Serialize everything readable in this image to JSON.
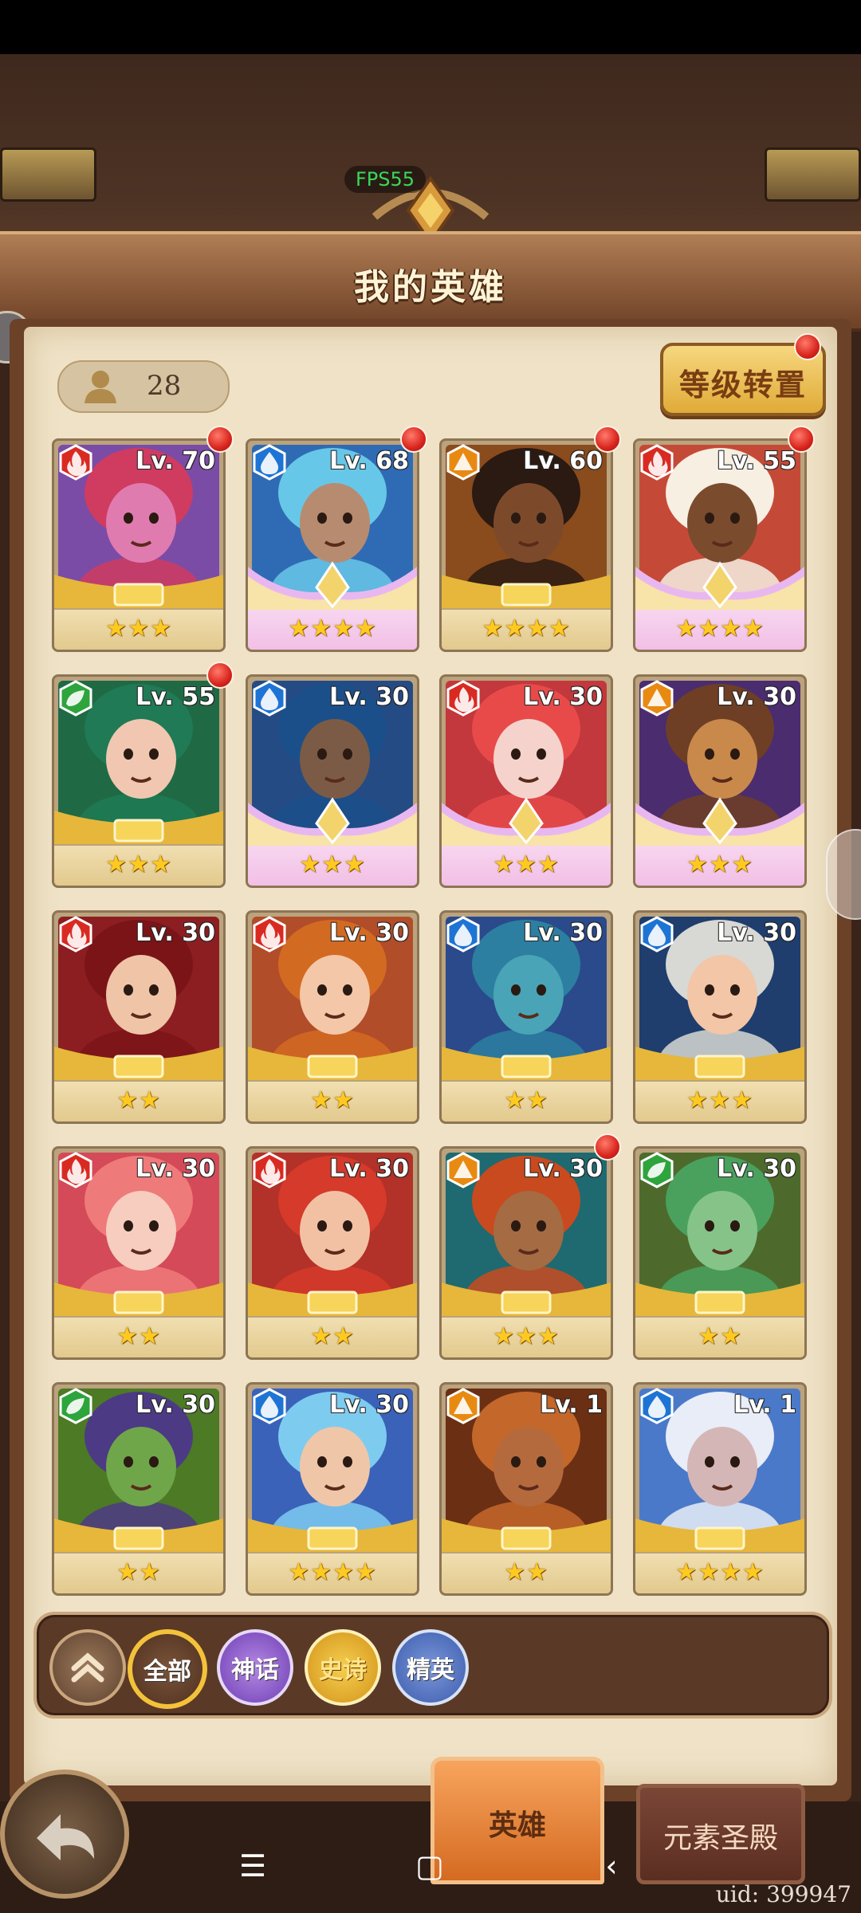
{
  "overlay": {
    "fps": "FPS55",
    "uid": "uid: 399947"
  },
  "header": {
    "title": "我的英雄"
  },
  "toolbar": {
    "hero_count": "28",
    "level_reset_label": "等级转置"
  },
  "filters": {
    "all": "全部",
    "mythic": "神话",
    "epic": "史诗",
    "elite": "精英"
  },
  "bottom_tabs": {
    "hero": "英雄",
    "element_temple": "元素圣殿"
  },
  "colors": {
    "fire": "#d92a22",
    "water": "#1e74d4",
    "earth": "#e88a12",
    "wood": "#2ea43c"
  },
  "heroes": [
    {
      "level": "Lv. 70",
      "stars": "★★★",
      "element": "fire",
      "rarity": "gold",
      "badge": true,
      "bg": "#7b4ca6",
      "skin": "#e07bb0",
      "hair": "#d03b60"
    },
    {
      "level": "Lv. 68",
      "stars": "★★★★",
      "element": "water",
      "rarity": "pink",
      "badge": true,
      "bg": "#2f6bb4",
      "skin": "#b78b70",
      "hair": "#67c7e8"
    },
    {
      "level": "Lv. 60",
      "stars": "★★★★",
      "element": "earth",
      "rarity": "gold",
      "badge": true,
      "bg": "#8a4b1d",
      "skin": "#7c4a2b",
      "hair": "#2a1a12"
    },
    {
      "level": "Lv. 55",
      "stars": "★★★★",
      "element": "fire",
      "rarity": "pink",
      "badge": true,
      "bg": "#c44a37",
      "skin": "#7b4b2e",
      "hair": "#f6efe2"
    },
    {
      "level": "Lv. 55",
      "stars": "★★★",
      "element": "wood",
      "rarity": "gold",
      "badge": true,
      "bg": "#1f6a45",
      "skin": "#f1c7b1",
      "hair": "#1f7a55"
    },
    {
      "level": "Lv. 30",
      "stars": "★★★",
      "element": "water",
      "rarity": "pink",
      "badge": false,
      "bg": "#254b85",
      "skin": "#7b5b45",
      "hair": "#1b4f8a"
    },
    {
      "level": "Lv. 30",
      "stars": "★★★",
      "element": "fire",
      "rarity": "pink",
      "badge": false,
      "bg": "#c3383c",
      "skin": "#f5d3cc",
      "hair": "#e84a4a"
    },
    {
      "level": "Lv. 30",
      "stars": "★★★",
      "element": "earth",
      "rarity": "pink",
      "badge": false,
      "bg": "#4a2c6f",
      "skin": "#c9894a",
      "hair": "#6e3f25"
    },
    {
      "level": "Lv. 30",
      "stars": "★★",
      "element": "fire",
      "rarity": "gold",
      "badge": false,
      "bg": "#8c1e21",
      "skin": "#f0c4a6",
      "hair": "#7a1417"
    },
    {
      "level": "Lv. 30",
      "stars": "★★",
      "element": "fire",
      "rarity": "gold",
      "badge": false,
      "bg": "#b14d29",
      "skin": "#f3c7a8",
      "hair": "#d36a22"
    },
    {
      "level": "Lv. 30",
      "stars": "★★",
      "element": "water",
      "rarity": "gold",
      "badge": false,
      "bg": "#2a4a8c",
      "skin": "#48a4b6",
      "hair": "#2c7fa0"
    },
    {
      "level": "Lv. 30",
      "stars": "★★★",
      "element": "water",
      "rarity": "gold",
      "badge": false,
      "bg": "#1f3d6d",
      "skin": "#f2c6a6",
      "hair": "#d8d8d4"
    },
    {
      "level": "Lv. 30",
      "stars": "★★",
      "element": "fire",
      "rarity": "gold",
      "badge": false,
      "bg": "#d44a58",
      "skin": "#f6cdbf",
      "hair": "#ef7a7a"
    },
    {
      "level": "Lv. 30",
      "stars": "★★",
      "element": "fire",
      "rarity": "gold",
      "badge": false,
      "bg": "#b23128",
      "skin": "#f2c1a4",
      "hair": "#d53a2a"
    },
    {
      "level": "Lv. 30",
      "stars": "★★★",
      "element": "earth",
      "rarity": "gold",
      "badge": true,
      "bg": "#1e6a70",
      "skin": "#a56b43",
      "hair": "#c94a1e"
    },
    {
      "level": "Lv. 30",
      "stars": "★★",
      "element": "wood",
      "rarity": "gold",
      "badge": false,
      "bg": "#4d6a2c",
      "skin": "#85c389",
      "hair": "#4aa15e"
    },
    {
      "level": "Lv. 30",
      "stars": "★★",
      "element": "wood",
      "rarity": "gold",
      "badge": false,
      "bg": "#4d7a25",
      "skin": "#6fa64a",
      "hair": "#4d3a85"
    },
    {
      "level": "Lv. 30",
      "stars": "★★★★",
      "element": "water",
      "rarity": "gold",
      "badge": false,
      "bg": "#3a62b9",
      "skin": "#f0c6a8",
      "hair": "#7ecbf0"
    },
    {
      "level": "Lv. 1",
      "stars": "★★",
      "element": "earth",
      "rarity": "gold",
      "badge": false,
      "bg": "#6b2f14",
      "skin": "#b56a3d",
      "hair": "#c4672a"
    },
    {
      "level": "Lv. 1",
      "stars": "★★★★",
      "element": "water",
      "rarity": "gold",
      "badge": false,
      "bg": "#4b79c9",
      "skin": "#d5b6b6",
      "hair": "#e8edf7"
    }
  ]
}
